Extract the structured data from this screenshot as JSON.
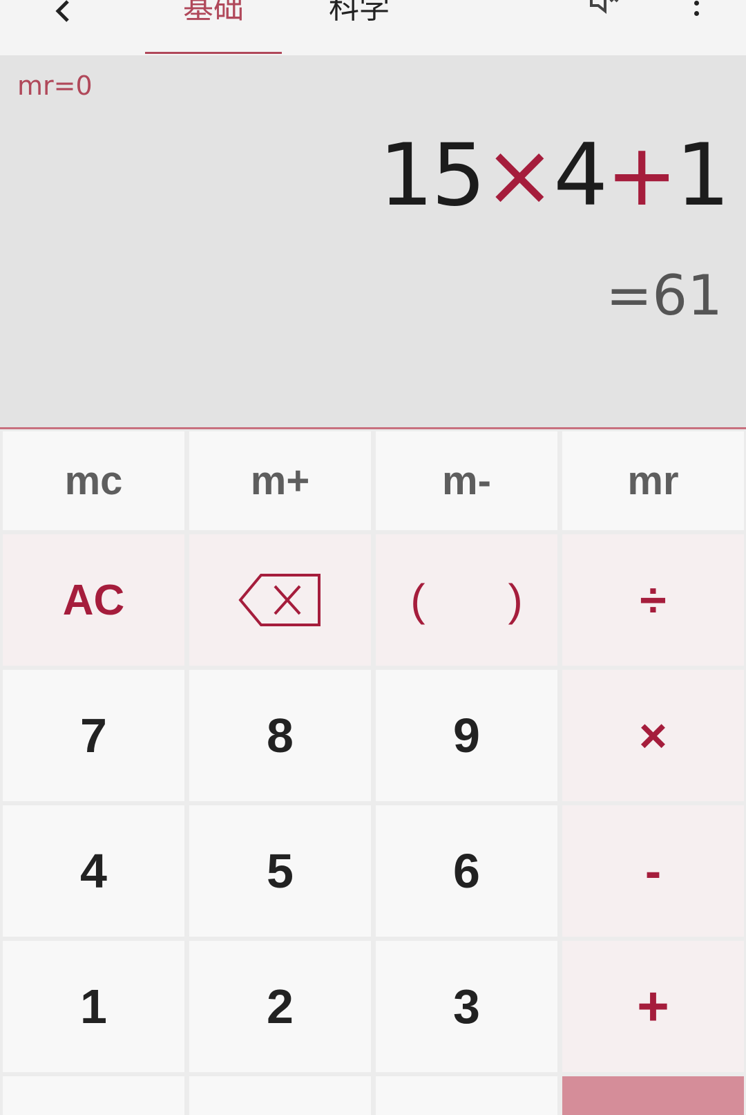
{
  "header": {
    "tabs": [
      "基础",
      "科学"
    ],
    "active_tab": "基础"
  },
  "display": {
    "memory_label": "mr=0",
    "expression": {
      "parts": [
        "15",
        "×",
        "4",
        "+",
        "1"
      ]
    },
    "result": "=61"
  },
  "keys": {
    "memory": [
      "mc",
      "m+",
      "m-",
      "mr"
    ],
    "clear": "AC",
    "paren_open": "(",
    "paren_close": ")",
    "divide": "÷",
    "row7": [
      "7",
      "8",
      "9"
    ],
    "multiply": "×",
    "row4": [
      "4",
      "5",
      "6"
    ],
    "minus": "-",
    "row1": [
      "1",
      "2",
      "3"
    ],
    "plus": "+"
  },
  "colors": {
    "accent": "#a51d3c",
    "tab_active": "#b0485a",
    "equals_bg": "#d58d99"
  },
  "icons": [
    "back-arrow-icon",
    "mute-icon",
    "more-vert-icon",
    "backspace-icon"
  ]
}
